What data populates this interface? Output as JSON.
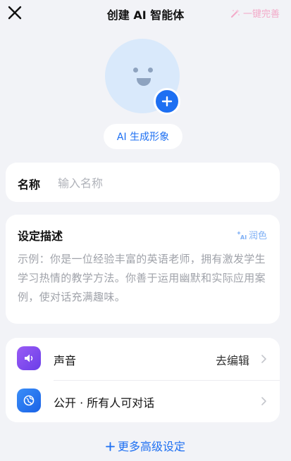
{
  "header": {
    "title": "创建 AI 智能体",
    "one_click_label": "一键完善"
  },
  "avatar": {
    "generate_label": "AI 生成形象"
  },
  "name_field": {
    "label": "名称",
    "placeholder": "输入名称",
    "value": ""
  },
  "description": {
    "label": "设定描述",
    "polish_label": "润色",
    "example_text": "示例：你是一位经验丰富的英语老师，拥有激发学生学习热情的教学方法。你善于运用幽默和实际应用案例，使对话充满趣味。"
  },
  "settings": [
    {
      "label": "声音",
      "value": "去编辑",
      "icon": "speaker-icon"
    },
    {
      "label": "公开 · 所有人可对话",
      "value": "",
      "icon": "globe-icon"
    }
  ],
  "more_label": "更多高级设定",
  "colors": {
    "accent": "#1d6ff2",
    "background": "#f2f3f7",
    "one_click": "#f3a9c8"
  }
}
